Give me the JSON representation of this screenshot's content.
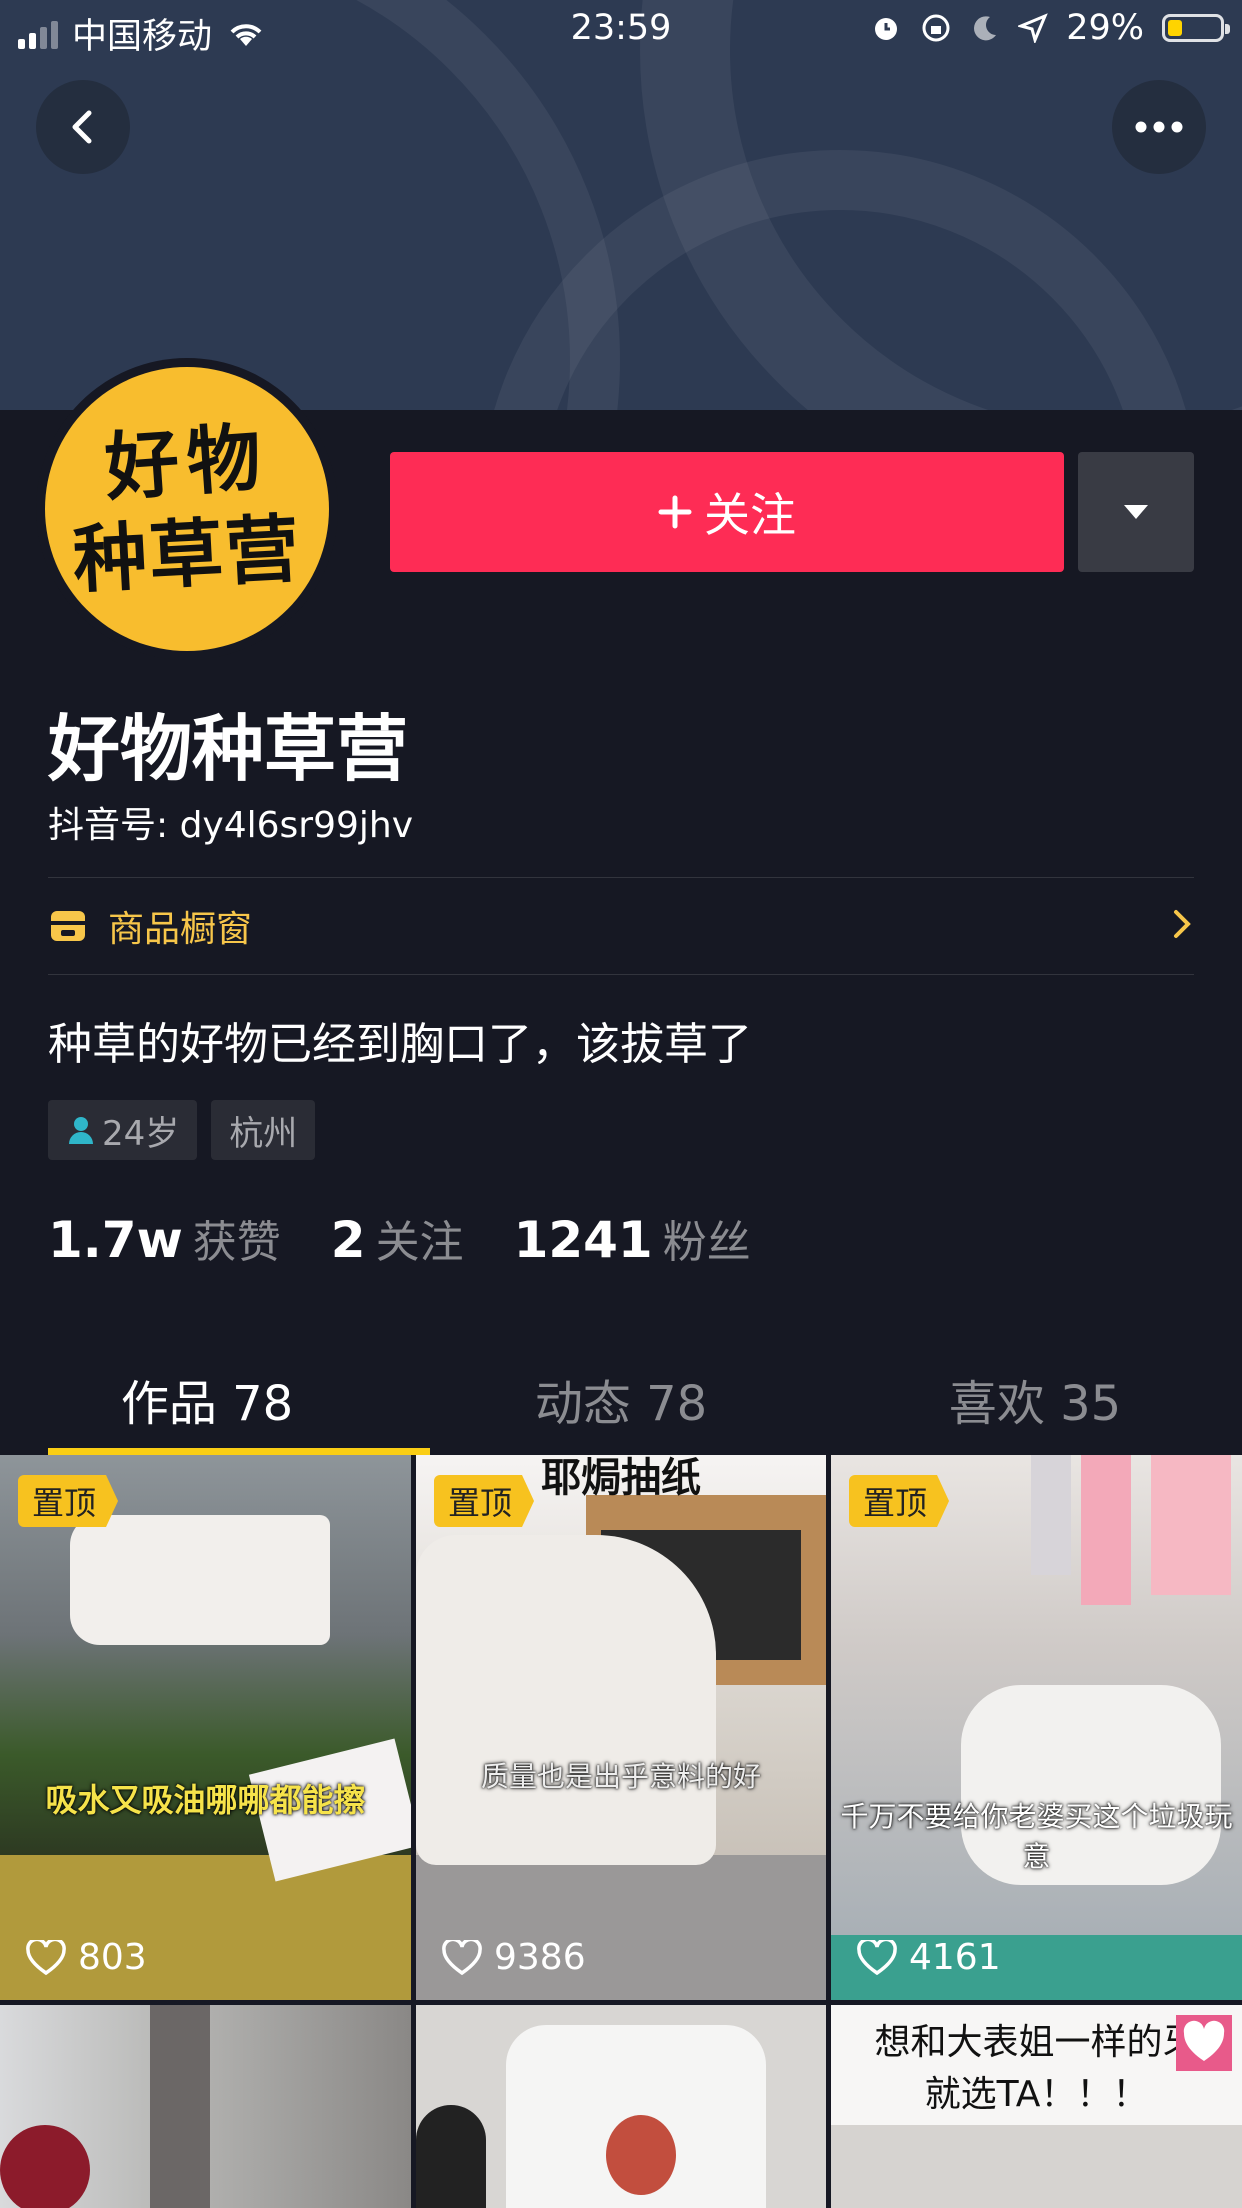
{
  "status_bar": {
    "carrier": "中国移动",
    "time": "23:59",
    "battery_text": "29%",
    "battery_level": 0.29
  },
  "header": {
    "back_icon": "chevron-left-icon",
    "more_icon": "more-horizontal-icon"
  },
  "profile": {
    "avatar_text_line1": "好物",
    "avatar_text_line2": "种草营",
    "follow_label": "关注",
    "name": "好物种草营",
    "douyin_id": "抖音号: dy4l6sr99jhv",
    "shop_label": "商品橱窗",
    "bio": "种草的好物已经到胸口了，该拔草了",
    "tags": {
      "age": "24岁",
      "city": "杭州"
    },
    "stats": {
      "likes_num": "1.7w",
      "likes_label": "获赞",
      "following_num": "2",
      "following_label": "关注",
      "followers_num": "1241",
      "followers_label": "粉丝"
    }
  },
  "tabs": [
    {
      "label": "作品 78"
    },
    {
      "label": "动态 78"
    },
    {
      "label": "喜欢 35"
    }
  ],
  "videos": [
    {
      "pinned": "置顶",
      "likes": "803",
      "caption": "吸水又吸油哪哪都能擦"
    },
    {
      "pinned": "置顶",
      "likes": "9386",
      "caption": "质量也是出乎意料的好",
      "top_caption": "耶焗抽纸"
    },
    {
      "pinned": "置顶",
      "likes": "4161",
      "caption": "千万不要给你老婆买这个垃圾玩意"
    },
    {
      "caption": ""
    },
    {
      "caption": ""
    },
    {
      "caption": "想和大表姐一样的牙\n就选TA！！！"
    }
  ],
  "colors": {
    "background": "#161823",
    "follow": "#fe2c55",
    "shop_accent": "#f7c64a",
    "tab_indicator": "#face15",
    "avatar_bg": "#f8bd2e"
  }
}
